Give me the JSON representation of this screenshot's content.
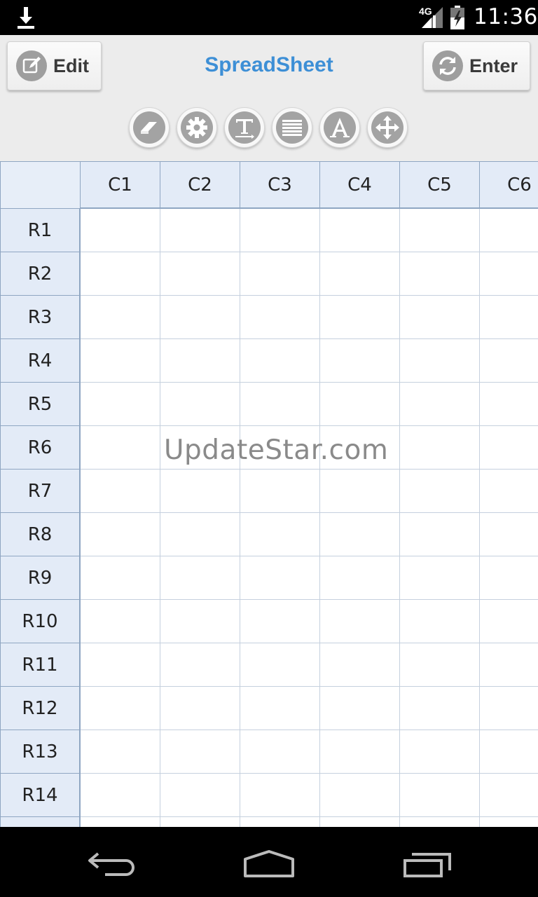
{
  "status_bar": {
    "network_label": "4G",
    "time": "11:36",
    "icons": [
      "download-icon",
      "signal-icon",
      "battery-icon"
    ]
  },
  "header": {
    "edit_label": "Edit",
    "title": "SpreadSheet",
    "enter_label": "Enter"
  },
  "toolbar": {
    "tools": [
      "eraser-icon",
      "gear-icon",
      "text-format-icon",
      "lines-icon",
      "font-icon",
      "move-icon"
    ]
  },
  "grid": {
    "columns": [
      "C1",
      "C2",
      "C3",
      "C4",
      "C5",
      "C6"
    ],
    "rows": [
      "R1",
      "R2",
      "R3",
      "R4",
      "R5",
      "R6",
      "R7",
      "R8",
      "R9",
      "R10",
      "R11",
      "R12",
      "R13",
      "R14"
    ]
  },
  "watermark": "UpdateStar.com",
  "colors": {
    "title": "#3d8fd6",
    "header_fill": "#e3ebf7",
    "grid_line": "#c5d0de"
  }
}
